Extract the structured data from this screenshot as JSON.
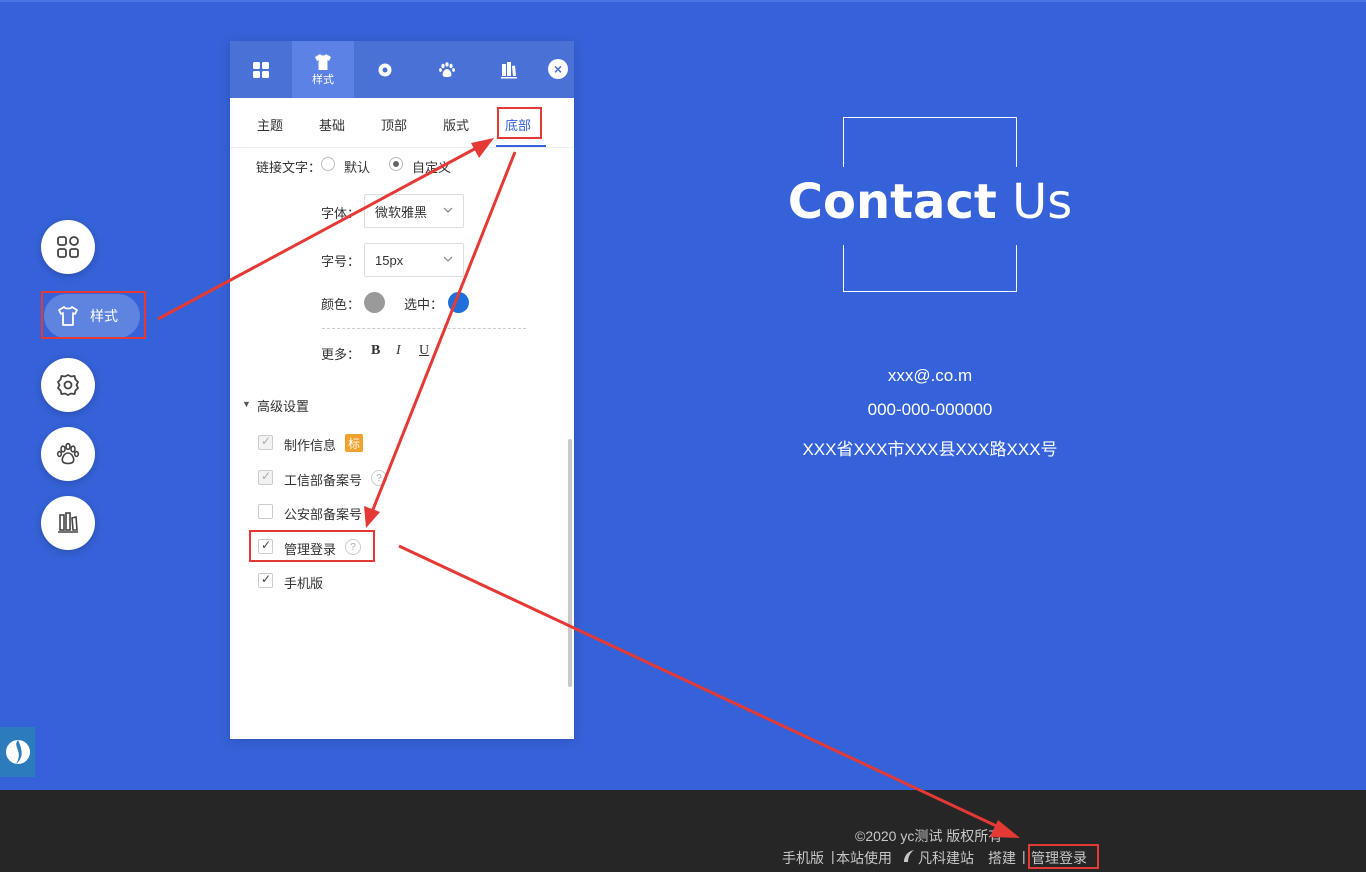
{
  "sidebar": {
    "style_label": "样式"
  },
  "panel": {
    "tabs": [
      {
        "label": "",
        "icon": "grid-icon"
      },
      {
        "label": "样式",
        "icon": "shirt-icon"
      },
      {
        "label": "",
        "icon": "gear-icon"
      },
      {
        "label": "",
        "icon": "paw-icon"
      },
      {
        "label": "",
        "icon": "books-icon"
      }
    ],
    "close_label": "×",
    "sub_tabs": [
      "主题",
      "基础",
      "顶部",
      "版式",
      "底部"
    ],
    "active_sub_tab": "底部",
    "link_text": {
      "label": "链接文字：",
      "option_default": "默认",
      "option_custom": "自定义",
      "selected": "自定义"
    },
    "font": {
      "label": "字体：",
      "value": "微软雅黑"
    },
    "size": {
      "label": "字号：",
      "value": "15px"
    },
    "color": {
      "label": "颜色：",
      "value": "#9a9a9a",
      "selected_label": "选中：",
      "selected_value": "#1e6fd9"
    },
    "more": {
      "label": "更多：",
      "bold": "B",
      "italic": "I",
      "underline": "U"
    },
    "advanced": {
      "title": "高级设置",
      "items": [
        {
          "label": "制作信息",
          "checked": true,
          "disabled": true,
          "badge": "标"
        },
        {
          "label": "工信部备案号",
          "checked": true,
          "disabled": true,
          "help": "?"
        },
        {
          "label": "公安部备案号",
          "checked": false,
          "disabled": false
        },
        {
          "label": "管理登录",
          "checked": true,
          "disabled": false,
          "help": "?"
        },
        {
          "label": "手机版",
          "checked": true,
          "disabled": false
        }
      ]
    }
  },
  "contact": {
    "title_bold": "Contact",
    "title_normal": "Us",
    "email": "xxx@.co.m",
    "phone": "000-000-000000",
    "address": "XXX省XXX市XXX县XXX路XXX号"
  },
  "footer": {
    "copyright": "©2020 yc测试 版权所有",
    "mobile": "手机版",
    "sep1": "|",
    "uses": "本站使用",
    "brand": "凡科建站",
    "built": "搭建",
    "sep2": "|",
    "admin_login": "管理登录"
  },
  "colors": {
    "page_bg": "#3562d8",
    "panel_head": "#4a71d6",
    "annotation": "#e53935",
    "footer_bg": "#262626"
  }
}
